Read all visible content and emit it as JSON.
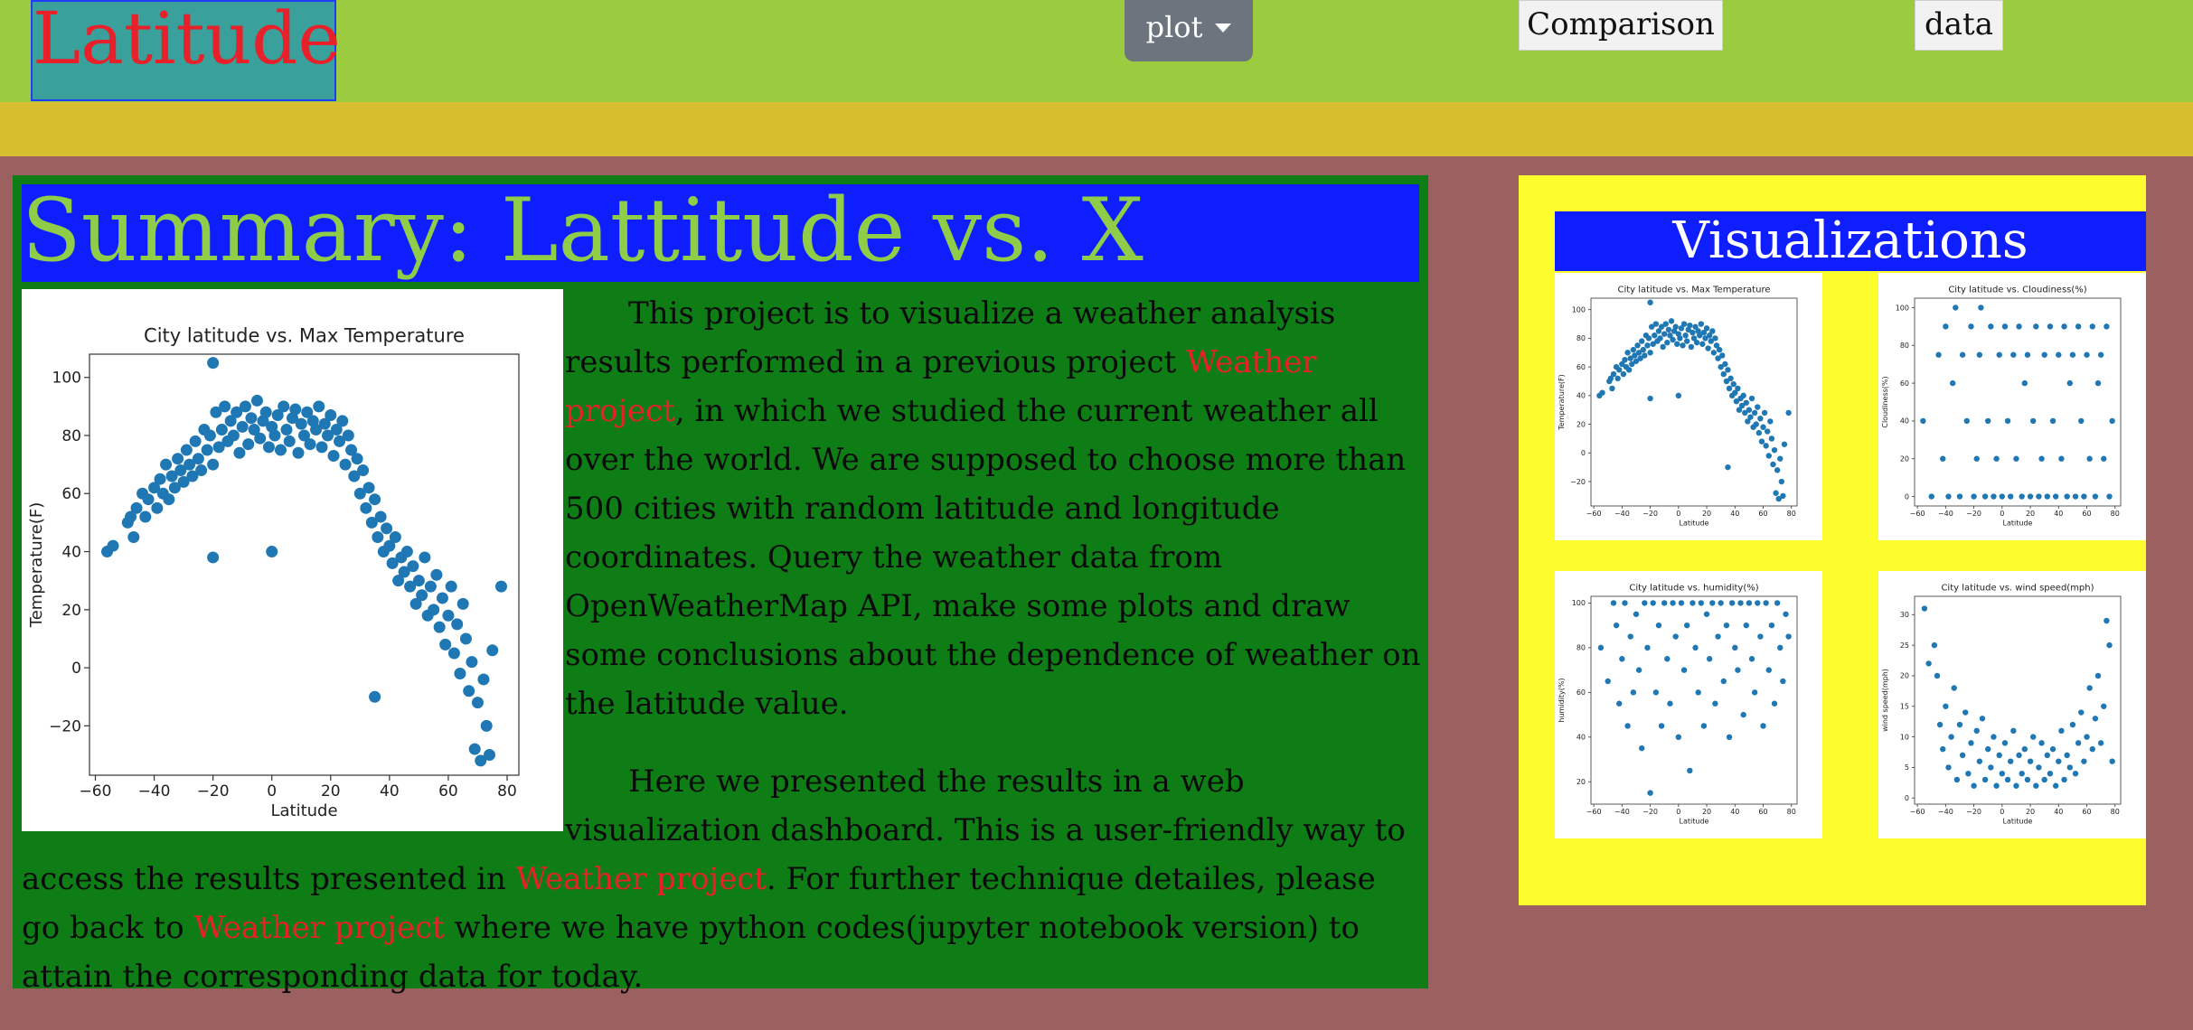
{
  "nav": {
    "brand": "Latitude",
    "plot_label": "plot",
    "comparison_label": "Comparison",
    "data_label": "data"
  },
  "summary": {
    "title": "Summary: Lattitude vs. X",
    "p1_a": "This project is to visualize a weather analysis results performed in a previous project ",
    "p1_link": "Weather project",
    "p1_b": ", in which we studied the current weather all over the world. We are supposed to choose more than 500 cities with random latitude and longitude coordinates. Query the weather data from OpenWeatherMap API, make some plots and draw some conclusions about the dependence of weather on the latitude value.",
    "p2_a": "Here we presented the results in a web visualization dashboard. This is a user-friendly way to access the results presented in ",
    "p2_link1": "Weather project",
    "p2_b": ". For further technique detailes, please go back to ",
    "p2_link2": "Weather project",
    "p2_c": " where we have python codes(jupyter notebook version) to attain the corresponding data for today."
  },
  "visualizations": {
    "title": "Visualizations"
  },
  "colors": {
    "scatter": "#1f77b4",
    "link": "#e8202a",
    "title_text": "#8fcc48"
  },
  "chart_data": [
    {
      "type": "scatter",
      "title": "City latitude vs. Max Temperature",
      "xlabel": "Latitude",
      "ylabel": "Temperature(F)",
      "xlim": [
        -62,
        84
      ],
      "ylim": [
        -37,
        108
      ],
      "xticks": [
        -60,
        -40,
        -20,
        0,
        20,
        40,
        60,
        80
      ],
      "yticks": [
        -20,
        0,
        20,
        40,
        60,
        80,
        100
      ],
      "points": [
        [
          -56,
          40
        ],
        [
          -54,
          42
        ],
        [
          -49,
          50
        ],
        [
          -48,
          52
        ],
        [
          -47,
          45
        ],
        [
          -46,
          55
        ],
        [
          -44,
          60
        ],
        [
          -43,
          52
        ],
        [
          -42,
          58
        ],
        [
          -40,
          62
        ],
        [
          -39,
          55
        ],
        [
          -38,
          65
        ],
        [
          -37,
          60
        ],
        [
          -36,
          70
        ],
        [
          -35,
          58
        ],
        [
          -34,
          66
        ],
        [
          -33,
          62
        ],
        [
          -32,
          72
        ],
        [
          -31,
          68
        ],
        [
          -30,
          64
        ],
        [
          -29,
          75
        ],
        [
          -28,
          70
        ],
        [
          -27,
          66
        ],
        [
          -26,
          78
        ],
        [
          -25,
          72
        ],
        [
          -24,
          68
        ],
        [
          -23,
          82
        ],
        [
          -22,
          75
        ],
        [
          -21,
          80
        ],
        [
          -20,
          105
        ],
        [
          -20,
          70
        ],
        [
          -19,
          88
        ],
        [
          -18,
          76
        ],
        [
          -17,
          82
        ],
        [
          -16,
          90
        ],
        [
          -15,
          78
        ],
        [
          -14,
          85
        ],
        [
          -13,
          80
        ],
        [
          -12,
          88
        ],
        [
          -11,
          74
        ],
        [
          -10,
          83
        ],
        [
          -9,
          90
        ],
        [
          -8,
          77
        ],
        [
          -7,
          86
        ],
        [
          -6,
          82
        ],
        [
          -5,
          92
        ],
        [
          -4,
          79
        ],
        [
          -3,
          85
        ],
        [
          -2,
          88
        ],
        [
          -1,
          76
        ],
        [
          0,
          83
        ],
        [
          1,
          80
        ],
        [
          2,
          87
        ],
        [
          3,
          75
        ],
        [
          4,
          90
        ],
        [
          5,
          82
        ],
        [
          6,
          78
        ],
        [
          7,
          86
        ],
        [
          8,
          89
        ],
        [
          9,
          74
        ],
        [
          10,
          84
        ],
        [
          11,
          80
        ],
        [
          12,
          88
        ],
        [
          13,
          77
        ],
        [
          14,
          85
        ],
        [
          15,
          82
        ],
        [
          16,
          90
        ],
        [
          17,
          76
        ],
        [
          18,
          84
        ],
        [
          19,
          80
        ],
        [
          20,
          87
        ],
        [
          21,
          73
        ],
        [
          22,
          82
        ],
        [
          23,
          78
        ],
        [
          24,
          85
        ],
        [
          25,
          70
        ],
        [
          26,
          80
        ],
        [
          27,
          75
        ],
        [
          28,
          66
        ],
        [
          29,
          72
        ],
        [
          30,
          60
        ],
        [
          31,
          68
        ],
        [
          32,
          55
        ],
        [
          33,
          62
        ],
        [
          34,
          50
        ],
        [
          35,
          58
        ],
        [
          36,
          45
        ],
        [
          37,
          52
        ],
        [
          38,
          40
        ],
        [
          39,
          48
        ],
        [
          40,
          42
        ],
        [
          41,
          36
        ],
        [
          42,
          45
        ],
        [
          43,
          30
        ],
        [
          44,
          38
        ],
        [
          45,
          33
        ],
        [
          46,
          40
        ],
        [
          47,
          28
        ],
        [
          48,
          35
        ],
        [
          49,
          22
        ],
        [
          50,
          30
        ],
        [
          51,
          25
        ],
        [
          52,
          38
        ],
        [
          53,
          18
        ],
        [
          54,
          28
        ],
        [
          55,
          20
        ],
        [
          56,
          32
        ],
        [
          57,
          14
        ],
        [
          58,
          24
        ],
        [
          59,
          8
        ],
        [
          60,
          18
        ],
        [
          61,
          28
        ],
        [
          62,
          5
        ],
        [
          63,
          15
        ],
        [
          64,
          -2
        ],
        [
          65,
          22
        ],
        [
          66,
          10
        ],
        [
          67,
          -8
        ],
        [
          68,
          2
        ],
        [
          69,
          -28
        ],
        [
          70,
          -12
        ],
        [
          71,
          -32
        ],
        [
          72,
          -4
        ],
        [
          73,
          -20
        ],
        [
          74,
          -30
        ],
        [
          75,
          6
        ],
        [
          -20,
          38
        ],
        [
          0,
          40
        ],
        [
          35,
          -10
        ],
        [
          78,
          28
        ]
      ]
    },
    {
      "type": "scatter",
      "title": "City latitude vs. Cloudiness(%)",
      "xlabel": "Latitude",
      "ylabel": "Cloudiness(%)",
      "xlim": [
        -62,
        84
      ],
      "ylim": [
        -5,
        105
      ],
      "xticks": [
        -60,
        -40,
        -20,
        0,
        20,
        40,
        60,
        80
      ],
      "yticks": [
        0,
        20,
        40,
        60,
        80,
        100
      ],
      "points": [
        [
          -56,
          40
        ],
        [
          -50,
          0
        ],
        [
          -45,
          75
        ],
        [
          -42,
          20
        ],
        [
          -40,
          90
        ],
        [
          -38,
          0
        ],
        [
          -35,
          60
        ],
        [
          -33,
          100
        ],
        [
          -30,
          0
        ],
        [
          -28,
          75
        ],
        [
          -25,
          40
        ],
        [
          -22,
          90
        ],
        [
          -20,
          0
        ],
        [
          -18,
          20
        ],
        [
          -16,
          75
        ],
        [
          -15,
          100
        ],
        [
          -12,
          0
        ],
        [
          -10,
          40
        ],
        [
          -8,
          90
        ],
        [
          -6,
          0
        ],
        [
          -4,
          20
        ],
        [
          -2,
          75
        ],
        [
          0,
          0
        ],
        [
          2,
          90
        ],
        [
          4,
          40
        ],
        [
          6,
          0
        ],
        [
          8,
          75
        ],
        [
          10,
          20
        ],
        [
          12,
          90
        ],
        [
          14,
          0
        ],
        [
          16,
          60
        ],
        [
          18,
          75
        ],
        [
          20,
          0
        ],
        [
          22,
          40
        ],
        [
          24,
          90
        ],
        [
          26,
          0
        ],
        [
          28,
          20
        ],
        [
          30,
          75
        ],
        [
          32,
          0
        ],
        [
          34,
          90
        ],
        [
          36,
          40
        ],
        [
          38,
          0
        ],
        [
          40,
          75
        ],
        [
          42,
          20
        ],
        [
          44,
          90
        ],
        [
          46,
          0
        ],
        [
          48,
          60
        ],
        [
          50,
          75
        ],
        [
          52,
          0
        ],
        [
          54,
          90
        ],
        [
          56,
          40
        ],
        [
          58,
          0
        ],
        [
          60,
          75
        ],
        [
          62,
          20
        ],
        [
          64,
          90
        ],
        [
          66,
          0
        ],
        [
          68,
          60
        ],
        [
          70,
          75
        ],
        [
          72,
          20
        ],
        [
          74,
          90
        ],
        [
          76,
          0
        ],
        [
          78,
          40
        ]
      ]
    },
    {
      "type": "scatter",
      "title": "City latitude vs. humidity(%)",
      "xlabel": "Latitude",
      "ylabel": "humidity(%)",
      "xlim": [
        -62,
        84
      ],
      "ylim": [
        10,
        103
      ],
      "xticks": [
        -60,
        -40,
        -20,
        0,
        20,
        40,
        60,
        80
      ],
      "yticks": [
        20,
        40,
        60,
        80,
        100
      ],
      "points": [
        [
          -55,
          80
        ],
        [
          -50,
          65
        ],
        [
          -46,
          100
        ],
        [
          -44,
          90
        ],
        [
          -42,
          55
        ],
        [
          -40,
          75
        ],
        [
          -38,
          100
        ],
        [
          -36,
          45
        ],
        [
          -34,
          85
        ],
        [
          -32,
          60
        ],
        [
          -30,
          95
        ],
        [
          -28,
          70
        ],
        [
          -26,
          35
        ],
        [
          -24,
          100
        ],
        [
          -22,
          80
        ],
        [
          -20,
          15
        ],
        [
          -18,
          100
        ],
        [
          -16,
          60
        ],
        [
          -14,
          90
        ],
        [
          -12,
          45
        ],
        [
          -10,
          100
        ],
        [
          -8,
          75
        ],
        [
          -6,
          55
        ],
        [
          -4,
          100
        ],
        [
          -2,
          85
        ],
        [
          0,
          40
        ],
        [
          2,
          100
        ],
        [
          4,
          70
        ],
        [
          6,
          90
        ],
        [
          8,
          25
        ],
        [
          10,
          100
        ],
        [
          12,
          80
        ],
        [
          14,
          60
        ],
        [
          16,
          100
        ],
        [
          18,
          45
        ],
        [
          20,
          95
        ],
        [
          22,
          75
        ],
        [
          24,
          100
        ],
        [
          26,
          55
        ],
        [
          28,
          85
        ],
        [
          30,
          100
        ],
        [
          32,
          65
        ],
        [
          34,
          90
        ],
        [
          36,
          40
        ],
        [
          38,
          100
        ],
        [
          40,
          80
        ],
        [
          42,
          70
        ],
        [
          44,
          100
        ],
        [
          46,
          50
        ],
        [
          48,
          90
        ],
        [
          50,
          100
        ],
        [
          52,
          75
        ],
        [
          54,
          60
        ],
        [
          56,
          100
        ],
        [
          58,
          85
        ],
        [
          60,
          45
        ],
        [
          62,
          100
        ],
        [
          64,
          70
        ],
        [
          66,
          90
        ],
        [
          68,
          55
        ],
        [
          70,
          100
        ],
        [
          72,
          80
        ],
        [
          74,
          65
        ],
        [
          76,
          95
        ],
        [
          78,
          85
        ]
      ]
    },
    {
      "type": "scatter",
      "title": "City latitude vs. wind speed(mph)",
      "xlabel": "Latitude",
      "ylabel": "wind speed(mph)",
      "xlim": [
        -62,
        84
      ],
      "ylim": [
        -1,
        33
      ],
      "xticks": [
        -60,
        -40,
        -20,
        0,
        20,
        40,
        60,
        80
      ],
      "yticks": [
        0,
        5,
        10,
        15,
        20,
        25,
        30
      ],
      "points": [
        [
          -55,
          31
        ],
        [
          -52,
          22
        ],
        [
          -48,
          25
        ],
        [
          -46,
          20
        ],
        [
          -44,
          12
        ],
        [
          -42,
          8
        ],
        [
          -40,
          15
        ],
        [
          -38,
          5
        ],
        [
          -36,
          10
        ],
        [
          -34,
          18
        ],
        [
          -32,
          3
        ],
        [
          -30,
          12
        ],
        [
          -28,
          7
        ],
        [
          -26,
          14
        ],
        [
          -24,
          4
        ],
        [
          -22,
          9
        ],
        [
          -20,
          2
        ],
        [
          -18,
          11
        ],
        [
          -16,
          6
        ],
        [
          -14,
          13
        ],
        [
          -12,
          3
        ],
        [
          -10,
          8
        ],
        [
          -8,
          5
        ],
        [
          -6,
          10
        ],
        [
          -4,
          2
        ],
        [
          -2,
          7
        ],
        [
          0,
          4
        ],
        [
          2,
          9
        ],
        [
          4,
          3
        ],
        [
          6,
          6
        ],
        [
          8,
          11
        ],
        [
          10,
          2
        ],
        [
          12,
          7
        ],
        [
          14,
          4
        ],
        [
          16,
          8
        ],
        [
          18,
          3
        ],
        [
          20,
          6
        ],
        [
          22,
          10
        ],
        [
          24,
          2
        ],
        [
          26,
          5
        ],
        [
          28,
          9
        ],
        [
          30,
          3
        ],
        [
          32,
          7
        ],
        [
          34,
          4
        ],
        [
          36,
          8
        ],
        [
          38,
          2
        ],
        [
          40,
          6
        ],
        [
          42,
          11
        ],
        [
          44,
          3
        ],
        [
          46,
          7
        ],
        [
          48,
          5
        ],
        [
          50,
          12
        ],
        [
          52,
          4
        ],
        [
          54,
          9
        ],
        [
          56,
          14
        ],
        [
          58,
          6
        ],
        [
          60,
          10
        ],
        [
          62,
          18
        ],
        [
          64,
          8
        ],
        [
          66,
          13
        ],
        [
          68,
          20
        ],
        [
          70,
          9
        ],
        [
          72,
          15
        ],
        [
          74,
          29
        ],
        [
          76,
          25
        ],
        [
          78,
          6
        ]
      ]
    }
  ]
}
